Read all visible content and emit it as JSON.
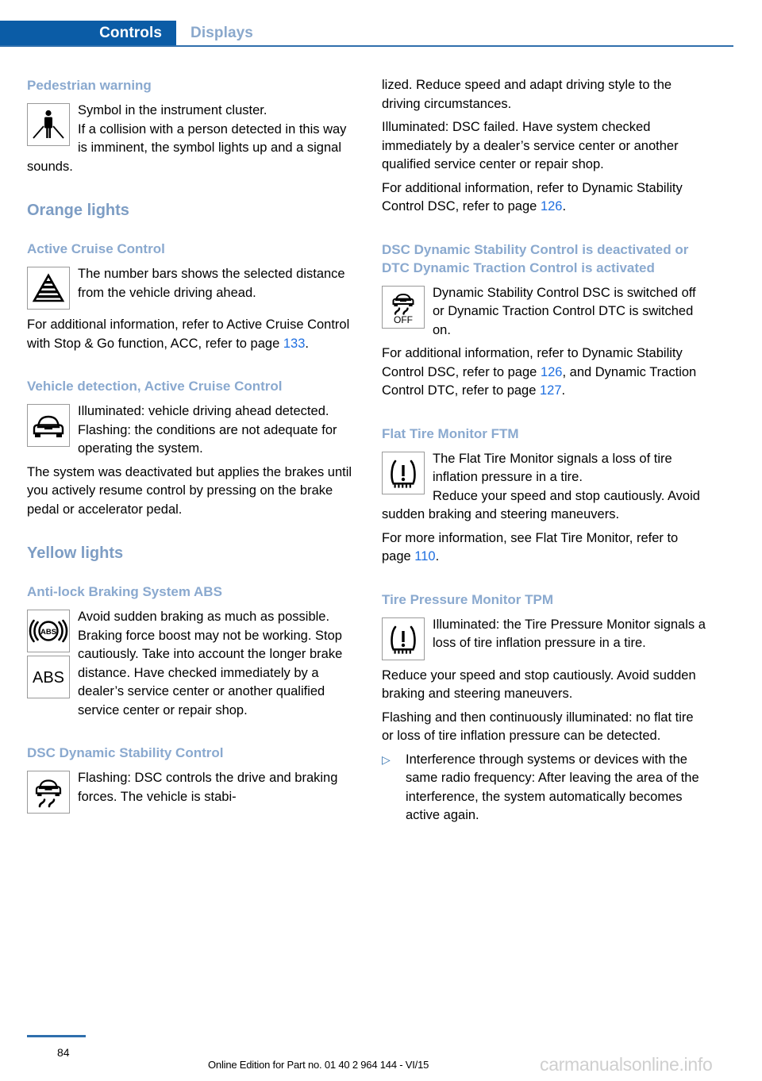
{
  "header": {
    "tab_active": "Controls",
    "tab_inactive": "Displays",
    "accent_color": "#0b5ca6",
    "inactive_color": "#8aa8cc"
  },
  "left_column": {
    "pedestrian": {
      "heading": "Pedestrian warning",
      "icon": "pedestrian-warning-icon",
      "text1": "Symbol in the instrument cluster.",
      "text2": "If a collision with a person detected in this way is imminent, the symbol lights up and a signal sounds."
    },
    "orange_lights_heading": "Orange lights",
    "acc": {
      "heading": "Active Cruise Control",
      "icon": "acc-distance-bars-icon",
      "text1": "The number bars shows the selected distance from the vehicle driving ahead.",
      "text2_a": "For additional information, refer to Active Cruise Control with Stop & Go function, ACC, refer to page ",
      "text2_page": "133",
      "text2_b": "."
    },
    "vehicle_detection": {
      "heading": "Vehicle detection, Active Cruise Control",
      "icon": "vehicle-front-icon",
      "text1": "Illuminated: vehicle driving ahead detected.",
      "text2": "Flashing: the conditions are not adequate for operating the system.",
      "text3": "The system was deactivated but applies the brakes until you actively resume control by pressing on the brake pedal or accelerator pedal."
    },
    "yellow_lights_heading": "Yellow lights",
    "abs": {
      "heading": "Anti-lock Braking System ABS",
      "icon1": "abs-circle-icon",
      "icon2": "abs-text-icon",
      "icon2_label": "ABS",
      "text1": "Avoid sudden braking as much as possible. Braking force boost may not be working. Stop cautiously. Take into account the longer brake distance. Have checked immediately by a dealer’s service center or another qualified service center or repair shop."
    },
    "dsc": {
      "heading": "DSC Dynamic Stability Control",
      "icon": "dsc-car-skid-icon",
      "text1": "Flashing: DSC controls the drive and braking forces. The vehicle is stabi-"
    }
  },
  "right_column": {
    "dsc_cont": {
      "text1": "lized. Reduce speed and adapt driving style to the driving circumstances.",
      "text2": "Illuminated: DSC failed. Have system checked immediately by a dealer’s service center or another qualified service center or repair shop.",
      "text3_a": "For additional information, refer to Dynamic Stability Control DSC, refer to page ",
      "text3_page": "126",
      "text3_b": "."
    },
    "dsc_off": {
      "heading": "DSC Dynamic Stability Control is deactivated or DTC Dynamic Traction Control is activated",
      "icon": "dsc-off-icon",
      "icon_label": "OFF",
      "text1": "Dynamic Stability Control DSC is switched off or Dynamic Traction Control DTC is switched on.",
      "text2_a": "For additional information, refer to Dynamic Stability Control DSC, refer to page ",
      "text2_page1": "126",
      "text2_b": ", and Dynamic Traction Control DTC, refer to page ",
      "text2_page2": "127",
      "text2_c": "."
    },
    "ftm": {
      "heading": "Flat Tire Monitor FTM",
      "icon": "tire-pressure-warning-icon",
      "text1": "The Flat Tire Monitor signals a loss of tire inflation pressure in a tire.",
      "text2": "Reduce your speed and stop cautiously. Avoid sudden braking and steering maneuvers.",
      "text3_a": "For more information, see Flat Tire Monitor, refer to page ",
      "text3_page": "110",
      "text3_b": "."
    },
    "tpm": {
      "heading": "Tire Pressure Monitor TPM",
      "icon": "tire-pressure-warning-icon",
      "text1": "Illuminated: the Tire Pressure Monitor signals a loss of tire inflation pressure in a tire.",
      "text2": "Reduce your speed and stop cautiously. Avoid sudden braking and steering maneuvers.",
      "text3": "Flashing and then continuously illuminated: no flat tire or loss of tire inflation pressure can be detected.",
      "bullet_marker": "▷",
      "bullet_text": "Interference through systems or devices with the same radio frequency: After leaving the area of the interference, the system automatically becomes active again."
    }
  },
  "footer": {
    "page_number": "84",
    "edition": "Online Edition for Part no. 01 40 2 964 144 - VI/15",
    "watermark": "carmanualsonline.info"
  }
}
